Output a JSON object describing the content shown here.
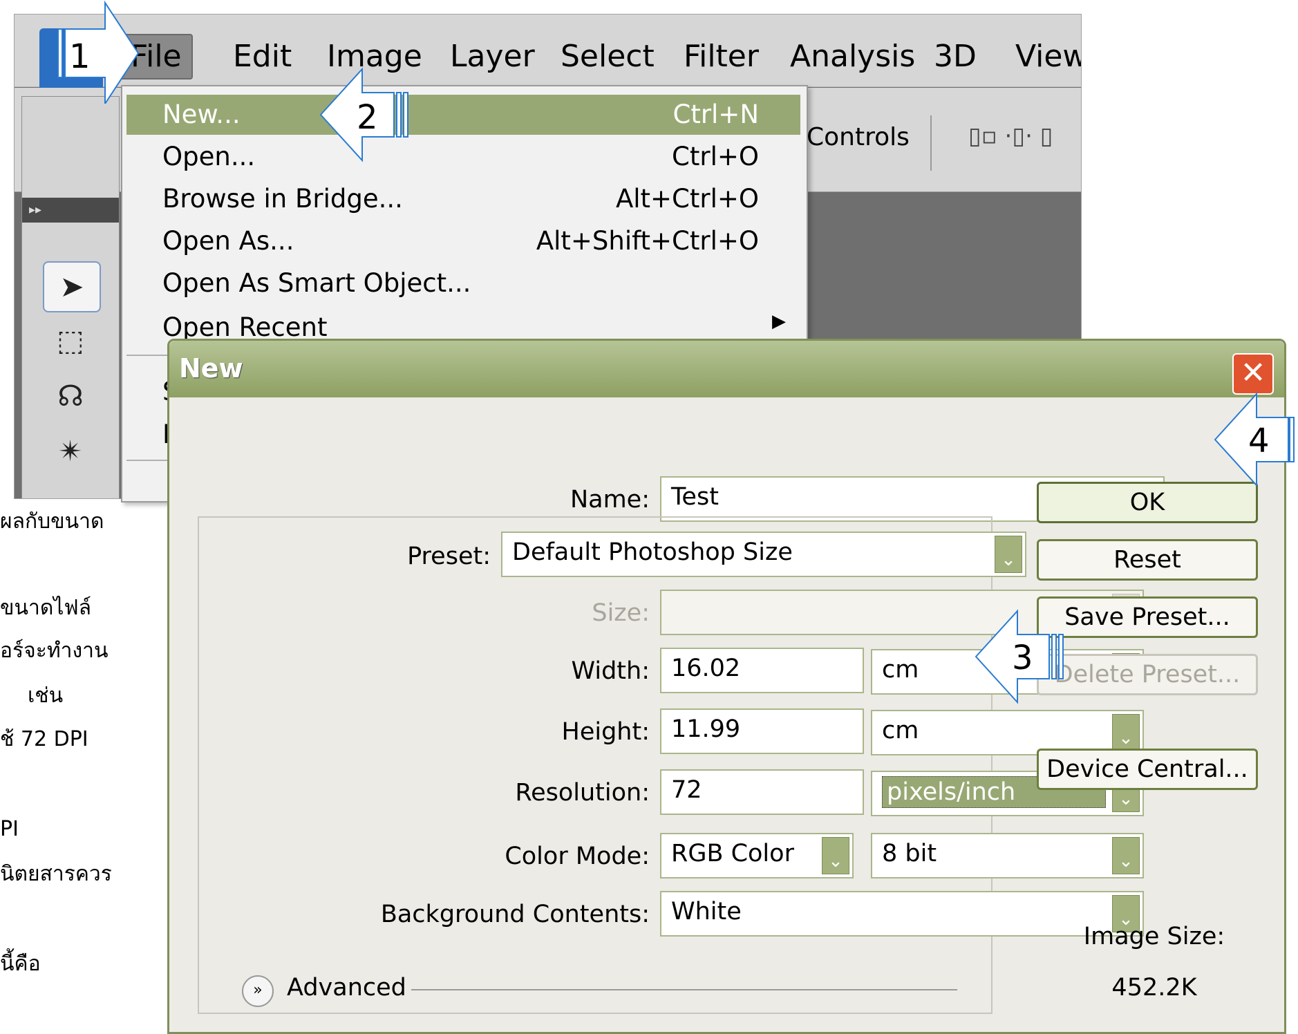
{
  "menubar": {
    "items": [
      "File",
      "Edit",
      "Image",
      "Layer",
      "Select",
      "Filter",
      "Analysis",
      "3D",
      "View"
    ]
  },
  "options_bar": {
    "controls_label": "Controls"
  },
  "file_menu": {
    "items": [
      {
        "label": "New...",
        "shortcut": "Ctrl+N"
      },
      {
        "label": "Open...",
        "shortcut": "Ctrl+O"
      },
      {
        "label": "Browse in Bridge...",
        "shortcut": "Alt+Ctrl+O"
      },
      {
        "label": "Open As...",
        "shortcut": "Alt+Shift+Ctrl+O"
      },
      {
        "label": "Open As Smart Object...",
        "shortcut": ""
      },
      {
        "label": "Open Recent",
        "shortcut": ""
      }
    ],
    "partial_1": "S",
    "partial_2": "D"
  },
  "background_text": {
    "lines": [
      "ผลกับขนาด",
      "ขนาดไฟล์",
      "อร์จะทำงาน",
      "เช่น",
      "ช้ 72 DPI",
      "PI",
      "นิตยสารควร",
      "นี้คือ"
    ]
  },
  "dialog": {
    "title": "New",
    "name_label": "Name:",
    "name_value": "Test",
    "preset_label": "Preset:",
    "preset_value": "Default Photoshop Size",
    "size_label": "Size:",
    "size_value": "",
    "width_label": "Width:",
    "width_value": "16.02",
    "width_unit": "cm",
    "height_label": "Height:",
    "height_value": "11.99",
    "height_unit": "cm",
    "resolution_label": "Resolution:",
    "resolution_value": "72",
    "resolution_unit": "pixels/inch",
    "color_mode_label": "Color Mode:",
    "color_mode_value": "RGB Color",
    "bit_depth_value": "8 bit",
    "background_label": "Background Contents:",
    "background_value": "White",
    "advanced_label": "Advanced",
    "image_size_label": "Image Size:",
    "image_size_value": "452.2K",
    "buttons": {
      "ok": "OK",
      "reset": "Reset",
      "save_preset": "Save Preset...",
      "delete_preset": "Delete Preset...",
      "device_central": "Device Central..."
    }
  },
  "callouts": [
    "1",
    "2",
    "3",
    "4"
  ],
  "colors": {
    "dialog_accent": "#98a874",
    "callout_stroke": "#2a7bd3",
    "close_button": "#e0532e"
  }
}
